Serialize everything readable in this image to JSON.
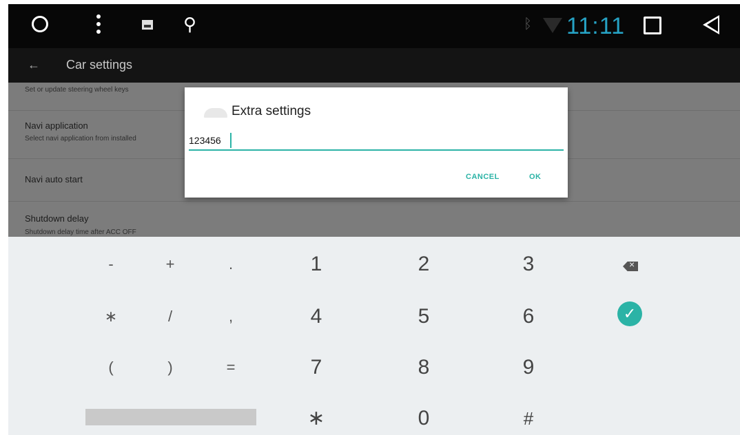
{
  "status_bar": {
    "clock": "11:11",
    "icons": [
      "home-icon",
      "menu-dots-icon",
      "gallery-icon",
      "usb-icon",
      "bluetooth-icon",
      "wifi-icon",
      "recent-apps-icon",
      "back-nav-icon"
    ],
    "clock_color": "#26a2c4"
  },
  "app_bar": {
    "back_glyph": "←",
    "title": "Car settings"
  },
  "settings": {
    "items": [
      {
        "subtitle": "Set or update steering wheel keys"
      },
      {
        "title": "Navi application",
        "subtitle": "Select navi application from installed"
      },
      {
        "title": "Navi auto start"
      },
      {
        "title": "Shutdown delay",
        "subtitle": "Shutdown delay time after ACC OFF"
      }
    ]
  },
  "dialog": {
    "title": "Extra settings",
    "input_value": "123456",
    "cancel_label": "CANCEL",
    "ok_label": "OK",
    "accent_color": "#2bb3a6"
  },
  "keyboard": {
    "row1": [
      "-",
      "+",
      ".",
      "1",
      "2",
      "3"
    ],
    "row2": [
      "∗",
      "/",
      ",",
      "4",
      "5",
      "6"
    ],
    "row3": [
      "(",
      ")",
      "=",
      "7",
      "8",
      "9"
    ],
    "row4": [
      "∗",
      "0",
      "#"
    ],
    "backspace_icon": "backspace-icon",
    "done_icon": "done-check-icon",
    "done_glyph": "✓"
  }
}
